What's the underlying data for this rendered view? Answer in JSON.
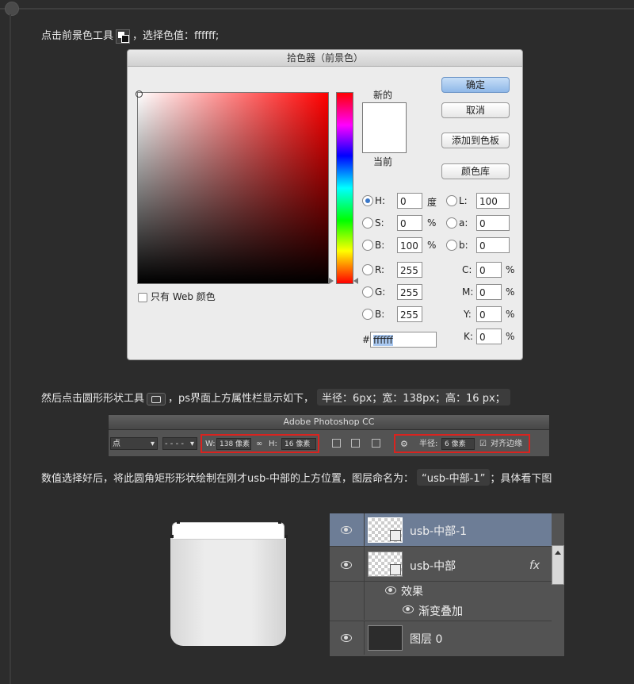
{
  "step1": {
    "text_before": "点击前景色工具",
    "text_after": "，选择色值：",
    "value": "ffffff;"
  },
  "dialog": {
    "title": "拾色器（前景色）",
    "web_only": "只有 Web 颜色",
    "new_label": "新的",
    "current_label": "当前",
    "buttons": {
      "ok": "确定",
      "cancel": "取消",
      "add_swatch": "添加到色板",
      "color_lib": "颜色库"
    },
    "hsb": [
      {
        "label": "H:",
        "value": "0",
        "unit": "度",
        "selected": true
      },
      {
        "label": "S:",
        "value": "0",
        "unit": "%"
      },
      {
        "label": "B:",
        "value": "100",
        "unit": "%"
      }
    ],
    "rgb": [
      {
        "label": "R:",
        "value": "255"
      },
      {
        "label": "G:",
        "value": "255"
      },
      {
        "label": "B:",
        "value": "255"
      }
    ],
    "lab": [
      {
        "label": "L:",
        "value": "100"
      },
      {
        "label": "a:",
        "value": "0"
      },
      {
        "label": "b:",
        "value": "0"
      }
    ],
    "cmyk": [
      {
        "label": "C:",
        "value": "0",
        "unit": "%"
      },
      {
        "label": "M:",
        "value": "0",
        "unit": "%"
      },
      {
        "label": "Y:",
        "value": "0",
        "unit": "%"
      },
      {
        "label": "K:",
        "value": "0",
        "unit": "%"
      }
    ],
    "hex_label": "#",
    "hex_value": "ffffff",
    "selected_color": "#ffffff"
  },
  "step2": {
    "text_before": "然后点击圆形形状工具",
    "text_after": "，ps界面上方属性栏显示如下，",
    "chip": "半径：6px；宽：138px；高：16 px；"
  },
  "toolbar": {
    "title": "Adobe Photoshop CC",
    "stroke_dd": "点",
    "w_label": "W:",
    "w_value": "138 像素",
    "h_label": "H:",
    "h_value": "16 像素",
    "radius_label": "半径:",
    "radius_value": "6 像素",
    "align_label": "对齐边缘"
  },
  "step3": {
    "text_before": "数值选择好后，将此圆角矩形形状绘制在刚才usb-中部的上方位置，图层命名为：",
    "chip": "“usb-中部-1”",
    "text_after": "；具体看下图"
  },
  "layers": {
    "items": [
      {
        "name": "usb-中部-1",
        "selected": true
      },
      {
        "name": "usb-中部",
        "fx": "fx"
      }
    ],
    "effects_label": "效果",
    "gradient_overlay": "渐变叠加",
    "bottom_layer": "图层 0"
  }
}
